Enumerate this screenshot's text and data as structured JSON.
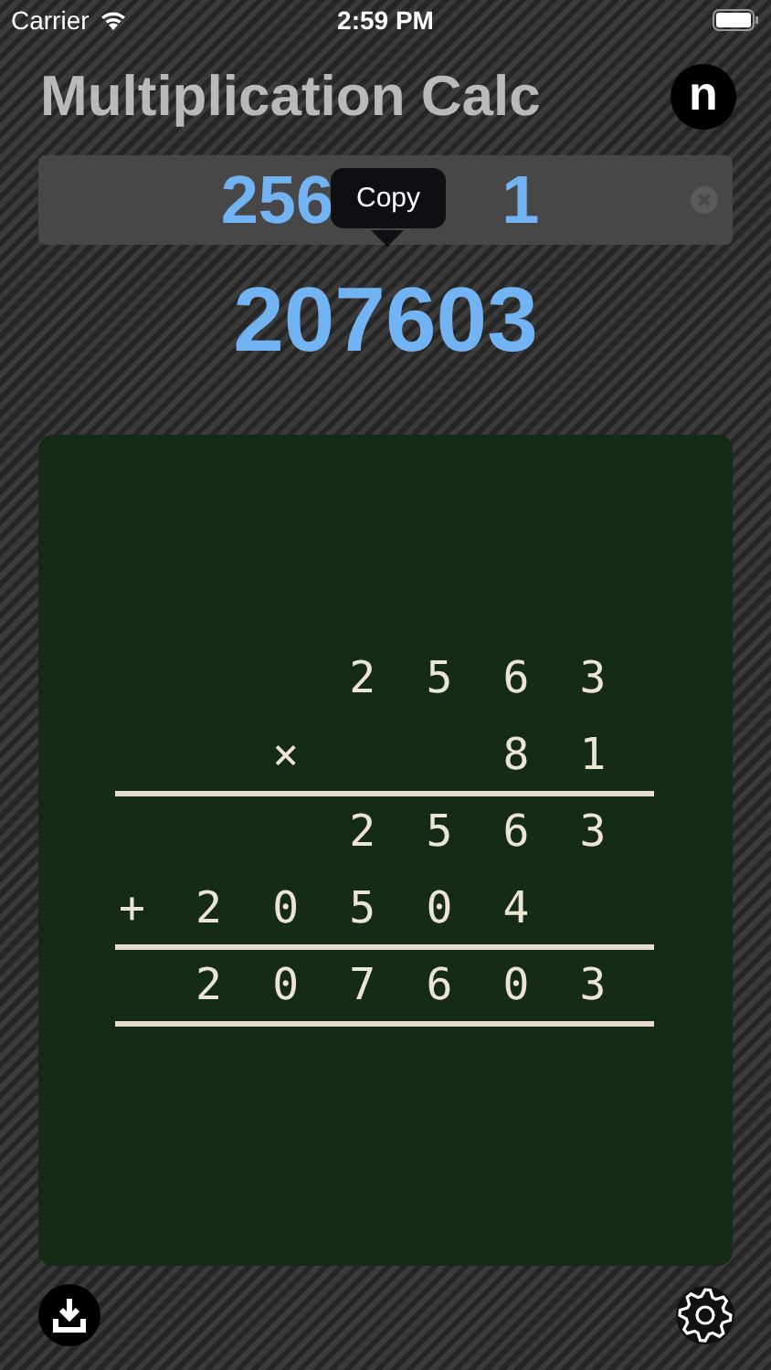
{
  "status_bar": {
    "carrier": "Carrier",
    "time": "2:59 PM"
  },
  "header": {
    "title": "Multiplication Calc",
    "badge": "n"
  },
  "input": {
    "visible_parts": [
      "256",
      "1"
    ]
  },
  "tooltip": {
    "label": "Copy"
  },
  "result": "207603",
  "board": {
    "rows": [
      {
        "text": "   2563",
        "rule_below": false
      },
      {
        "text": "  ×  81",
        "rule_below": true
      },
      {
        "text": "   2563",
        "rule_below": false
      },
      {
        "text": "+20504 ",
        "rule_below": true
      },
      {
        "text": " 207603",
        "rule_below": true
      }
    ]
  }
}
